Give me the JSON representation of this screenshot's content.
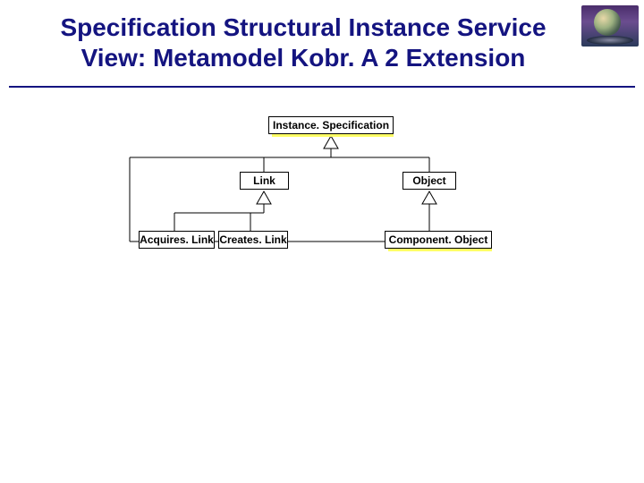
{
  "title": {
    "line1": "Specification Structural Instance Service",
    "line2": "View: Metamodel Kobr. A 2 Extension"
  },
  "nodes": {
    "instanceSpecification": "Instance. Specification",
    "link": "Link",
    "object": "Object",
    "acquiresLink": "Acquires. Link",
    "createsLink": "Creates. Link",
    "componentObject": "Component. Object"
  },
  "colors": {
    "titleColor": "#141480",
    "nodeHighlight": "#ffff66"
  }
}
